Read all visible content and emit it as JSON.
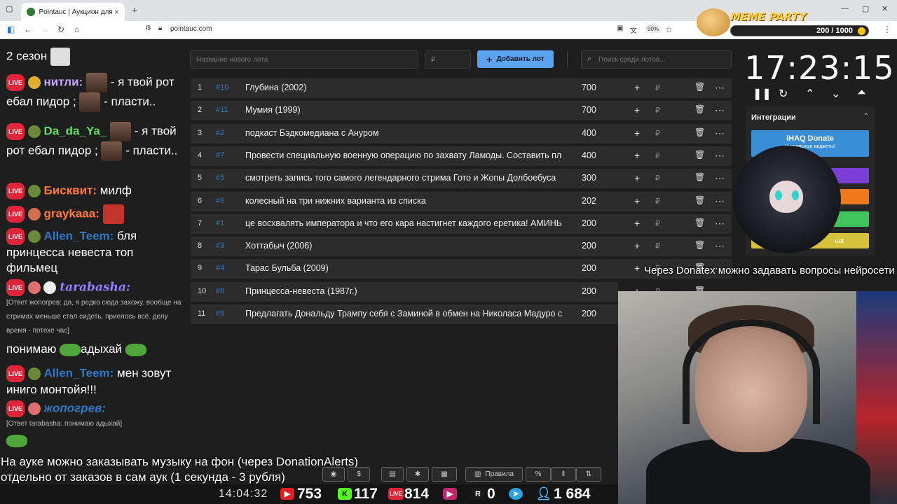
{
  "browser": {
    "tab_title": "Pointauc | Аукцион для стриме",
    "url": "pointauc.com",
    "zoom": "90%"
  },
  "meme_party": {
    "title": "MEME PARTY",
    "count": "200 / 1000"
  },
  "chat": {
    "messages": [
      {
        "text": "2 сезон"
      },
      {
        "nick": "нитли:",
        "text": "- я твой рот ебал пидор ;",
        "tail": "- пласти.."
      },
      {
        "nick": "Da_da_Ya_",
        "text": "- я твой рот ебал пидор ;",
        "tail": "- пласти.."
      },
      {
        "nick": "Бисквит:",
        "text": "милф"
      },
      {
        "nick": "graykaaa:"
      },
      {
        "nick": "Allen_Teem:",
        "text": "бля принцесса невеста топ фильмец"
      },
      {
        "nick": "tarabasha:",
        "reply": "[Ответ жопогрев: да, я редко сюда захожу. вообще на стримах меньше стал сидеть, приелось всё. делу время - потехе час]"
      },
      {
        "text": "понимаю",
        "tail": "адыхай"
      },
      {
        "nick": "Allen_Teem:",
        "text": "мен зовут иниго монтойя!!!"
      },
      {
        "nick": "жопогрев:",
        "reply": "[Ответ tarabasha: понимаю адыхай]"
      }
    ]
  },
  "auction": {
    "new_lot_placeholder": "Название нового лота",
    "amount_placeholder": "₽",
    "add_button": "Добавить лот",
    "search_placeholder": "Поиск среди лотов...",
    "lots": [
      {
        "idx": "1",
        "id": "#10",
        "name": "Глубина (2002)",
        "amount": "700"
      },
      {
        "idx": "2",
        "id": "#11",
        "name": "Мумия (1999)",
        "amount": "700"
      },
      {
        "idx": "3",
        "id": "#2",
        "name": "подкаст Бэдкомедиана с Ануром",
        "amount": "400"
      },
      {
        "idx": "4",
        "id": "#7",
        "name": "Провести специальную военную операцию по захвату Ламоды. Составить пла",
        "amount": "400"
      },
      {
        "idx": "5",
        "id": "#5",
        "name": "смотреть запись того самого легендарного стрима Гото и Жопы Долбоебуса",
        "amount": "300"
      },
      {
        "idx": "6",
        "id": "#6",
        "name": "колесный на три нижних варианта из списка",
        "amount": "202"
      },
      {
        "idx": "7",
        "id": "#1",
        "name": "це восхвалять императора и что его кара настигнет каждого еретика! АМИНЬ!",
        "amount": "200"
      },
      {
        "idx": "8",
        "id": "#3",
        "name": "Хоттабыч (2006)",
        "amount": "200"
      },
      {
        "idx": "9",
        "id": "#4",
        "name": "Тарас Бульба (2009)",
        "amount": "200"
      },
      {
        "idx": "10",
        "id": "#8",
        "name": "Принцесса-невеста (1987г.)",
        "amount": "200"
      },
      {
        "idx": "11",
        "id": "#9",
        "name": "Предлагать Дональду Трампу себя с Заминой в обмен на Николаса Мадуро с",
        "amount": "200"
      }
    ],
    "currency": "₽"
  },
  "timer": {
    "time": "17:23:15"
  },
  "integrations": {
    "title": "Интеграции",
    "ihaq_label": "IHAQ Donate",
    "ihaq_sub": "Уникальные виджеты!",
    "bottom_label": "uet",
    "colors": [
      "#7b3fd6",
      "#f07a1a",
      "#3ec45a",
      "#d6c23a"
    ]
  },
  "overlay": {
    "donatex_note": "Через Donatex можно задавать вопросы нейросети",
    "subtitle_1": "На ауке можно заказывать музыку на фон (через DonationAlerts)",
    "subtitle_2": "отдельно от заказов в сам аук (1 секунда - 3 рубля)"
  },
  "controls": {
    "rules_label": "Правила",
    "percent": "%"
  },
  "stats": {
    "clock": "14:04:32",
    "youtube": "753",
    "kick": "117",
    "live": "814",
    "rutube": "0",
    "viewers": "1 684"
  }
}
